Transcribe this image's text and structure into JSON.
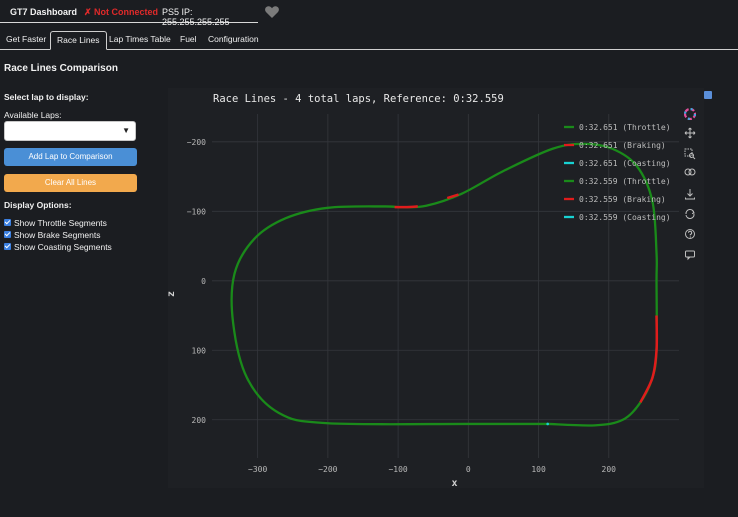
{
  "header": {
    "app_title": "GT7 Dashboard",
    "connection_status": "✗ Not Connected",
    "ps5_ip": "PS5 IP: 255.255.255.255",
    "favorite_icon": "heart-icon",
    "status_color": "#e02a2a"
  },
  "tabs": [
    {
      "label": "Get Faster"
    },
    {
      "label": "Race Lines",
      "active": true
    },
    {
      "label": "Lap Times Table"
    },
    {
      "label": "Fuel"
    },
    {
      "label": "Configuration"
    }
  ],
  "section_title": "Race Lines Comparison",
  "controls": {
    "select_lap_heading": "Select lap to display:",
    "available_laps_label": "Available Laps:",
    "laps_select_value": "",
    "add_lap_button": "Add Lap to Comparison",
    "clear_button": "Clear All Lines",
    "display_options_heading": "Display Options:",
    "options": [
      {
        "label": "Show Throttle Segments",
        "checked": true
      },
      {
        "label": "Show Brake Segments",
        "checked": true
      },
      {
        "label": "Show Coasting Segments",
        "checked": true
      }
    ]
  },
  "modebar_icons": [
    "plotly-logo-icon",
    "pan-icon",
    "zoom-icon",
    "lasso-icon",
    "download-icon",
    "reset-icon",
    "help-icon",
    "hover-icon"
  ],
  "chart_data": {
    "type": "line",
    "title": "Race Lines - 4 total laps, Reference: 0:32.559",
    "xlabel": "x",
    "ylabel": "z",
    "xlim": [
      -365,
      300
    ],
    "ylim": [
      255,
      -240
    ],
    "x_ticks": [
      -300,
      -200,
      -100,
      0,
      100,
      200
    ],
    "y_ticks": [
      -200,
      -100,
      0,
      100,
      200
    ],
    "grid": true,
    "legend_position": "top-right",
    "colors": {
      "throttle": "#1a8a1a",
      "braking": "#e01c1c",
      "coasting": "#18d2d2"
    },
    "legend": [
      {
        "name": "0:32.651 (Throttle)",
        "color": "#1a8a1a"
      },
      {
        "name": "0:32.651 (Braking)",
        "color": "#e01c1c"
      },
      {
        "name": "0:32.651 (Coasting)",
        "color": "#18d2d2"
      },
      {
        "name": "0:32.559 (Throttle)",
        "color": "#1a8a1a"
      },
      {
        "name": "0:32.559 (Braking)",
        "color": "#e01c1c"
      },
      {
        "name": "0:32.559 (Coasting)",
        "color": "#18d2d2"
      }
    ],
    "track": [
      [
        114,
        206
      ],
      [
        0,
        206
      ],
      [
        -200,
        205
      ],
      [
        -270,
        190
      ],
      [
        -315,
        140
      ],
      [
        -335,
        60
      ],
      [
        -333,
        -10
      ],
      [
        -305,
        -60
      ],
      [
        -260,
        -90
      ],
      [
        -200,
        -105
      ],
      [
        -120,
        -107
      ],
      [
        -95,
        -106
      ],
      [
        -60,
        -108
      ],
      [
        -10,
        -125
      ],
      [
        50,
        -158
      ],
      [
        120,
        -190
      ],
      [
        165,
        -197
      ],
      [
        205,
        -190
      ],
      [
        240,
        -165
      ],
      [
        262,
        -115
      ],
      [
        268,
        -40
      ],
      [
        268,
        0
      ],
      [
        268,
        100
      ],
      [
        262,
        140
      ],
      [
        245,
        175
      ],
      [
        220,
        200
      ],
      [
        180,
        208
      ],
      [
        114,
        206
      ]
    ],
    "braking_segments": [
      [
        [
          -105,
          -106
        ],
        [
          -90,
          -106
        ],
        [
          -72,
          -107
        ]
      ],
      [
        [
          -30,
          -119
        ],
        [
          -14,
          -124
        ]
      ],
      [
        [
          268,
          50
        ],
        [
          268,
          100
        ],
        [
          262,
          140
        ],
        [
          245,
          175
        ]
      ]
    ],
    "coasting_points": [
      [
        113,
        206
      ]
    ]
  }
}
